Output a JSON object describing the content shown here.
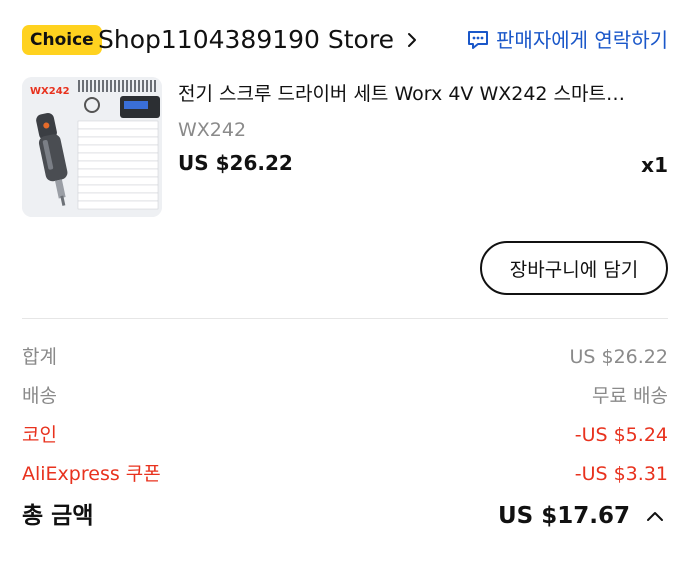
{
  "store": {
    "badge": "Choice",
    "name": "Shop1104389190 Store",
    "contact_label": "판매자에게 연락하기"
  },
  "product": {
    "title": "전기 스크루 드라이버 세트 Worx 4V WX242 스마트…",
    "variant": "WX242",
    "price": "US $26.22",
    "quantity": "x1",
    "image_brand_text": "WX242"
  },
  "actions": {
    "add_to_cart": "장바구니에 담기"
  },
  "summary": {
    "rows": [
      {
        "label": "합계",
        "value": "US $26.22"
      },
      {
        "label": "배송",
        "value": "무료 배송"
      },
      {
        "label": "코인",
        "value": "-US $5.24"
      },
      {
        "label": "AliExpress 쿠폰",
        "value": "-US $3.31"
      }
    ],
    "total_label": "총 금액",
    "total_value": "US $17.67"
  },
  "colors": {
    "choice_badge": "#ffd21f",
    "link_blue": "#1a57c9",
    "discount_red": "#e8321e",
    "muted_gray": "#8a8a8a"
  },
  "icons": {
    "store_chevron": "chevron-right-icon",
    "contact": "chat-bubble-icon",
    "total_toggle": "chevron-up-icon"
  }
}
